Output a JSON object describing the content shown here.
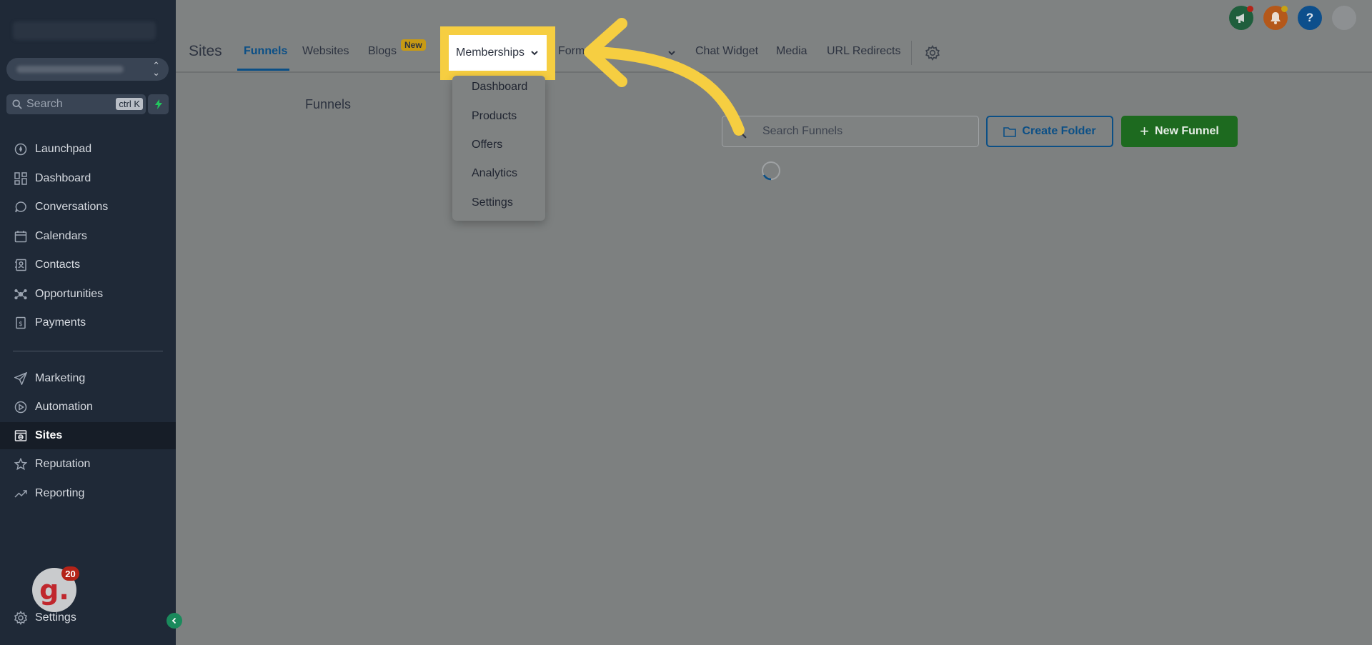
{
  "sidebar": {
    "search_label": "Search",
    "search_shortcut": "ctrl K",
    "items": [
      {
        "label": "Launchpad",
        "icon": "rocket-icon"
      },
      {
        "label": "Dashboard",
        "icon": "grid-icon"
      },
      {
        "label": "Conversations",
        "icon": "chat-icon"
      },
      {
        "label": "Calendars",
        "icon": "calendar-icon"
      },
      {
        "label": "Contacts",
        "icon": "contacts-icon"
      },
      {
        "label": "Opportunities",
        "icon": "network-icon"
      },
      {
        "label": "Payments",
        "icon": "receipt-icon"
      },
      {
        "label": "Marketing",
        "icon": "send-icon"
      },
      {
        "label": "Automation",
        "icon": "play-circle-icon"
      },
      {
        "label": "Sites",
        "icon": "globe-icon",
        "active": true
      },
      {
        "label": "Reputation",
        "icon": "star-icon"
      },
      {
        "label": "Reporting",
        "icon": "trend-icon"
      }
    ],
    "badge_letter": "g.",
    "badge_count": "20",
    "settings_label": "Settings"
  },
  "header": {
    "title": "Sites",
    "tabs": [
      {
        "label": "Funnels",
        "active": true
      },
      {
        "label": "Websites"
      },
      {
        "label": "Blogs",
        "badge": "New"
      },
      {
        "label": "Memberships"
      },
      {
        "label": "Forms"
      },
      {
        "label": "Chat Widget"
      },
      {
        "label": "Media"
      },
      {
        "label": "URL Redirects"
      }
    ]
  },
  "dropdown": {
    "items": [
      "Dashboard",
      "Products",
      "Offers",
      "Analytics",
      "Settings"
    ]
  },
  "main": {
    "title": "Funnels",
    "search_placeholder": "Search Funnels",
    "create_folder_label": "Create Folder",
    "new_funnel_label": "New Funnel"
  },
  "colors": {
    "highlight": "#f6ce41",
    "active_tab": "#0b4f86",
    "primary_green": "#1d6a1f",
    "sidebar_bg": "#1f2937"
  }
}
